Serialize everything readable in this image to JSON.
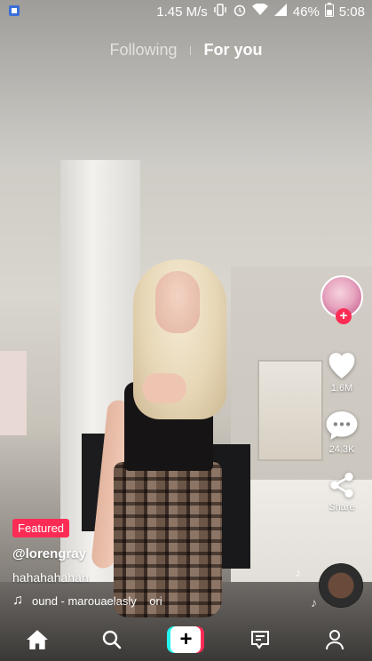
{
  "status_bar": {
    "speed": "1.45 M/s",
    "battery": "46%",
    "time": "5:08"
  },
  "top_tabs": {
    "following": "Following",
    "for_you": "For you"
  },
  "rail": {
    "likes": "1.6M",
    "comments": "24.3K",
    "share": "Share"
  },
  "caption": {
    "badge": "Featured",
    "username": "@lorengray",
    "description": "hahahahahah",
    "sound": "ound - marouaelasly    ori"
  },
  "colors": {
    "accent": "#fe2c55",
    "cyan": "#25f4ee"
  }
}
